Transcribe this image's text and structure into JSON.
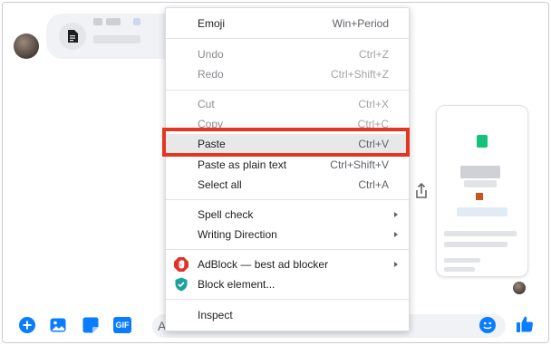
{
  "composer": {
    "input_placeholder": "Aa",
    "icons": [
      "plus-circle-icon",
      "image-icon",
      "sticker-icon",
      "gif-icon",
      "emoji-icon",
      "thumbs-up-icon"
    ],
    "gif_label": "GIF",
    "accent_color": "#0a7cff"
  },
  "context_menu": {
    "emoji": {
      "label": "Emoji",
      "shortcut": "Win+Period"
    },
    "undo": {
      "label": "Undo",
      "shortcut": "Ctrl+Z"
    },
    "redo": {
      "label": "Redo",
      "shortcut": "Ctrl+Shift+Z"
    },
    "cut": {
      "label": "Cut",
      "shortcut": "Ctrl+X"
    },
    "copy": {
      "label": "Copy",
      "shortcut": "Ctrl+C"
    },
    "paste": {
      "label": "Paste",
      "shortcut": "Ctrl+V"
    },
    "paste_plain": {
      "label": "Paste as plain text",
      "shortcut": "Ctrl+Shift+V"
    },
    "select_all": {
      "label": "Select all",
      "shortcut": "Ctrl+A"
    },
    "spell_check": {
      "label": "Spell check"
    },
    "writing_direction": {
      "label": "Writing Direction"
    },
    "adblock": {
      "label": "AdBlock — best ad blocker"
    },
    "block_element": {
      "label": "Block element..."
    },
    "inspect": {
      "label": "Inspect"
    }
  },
  "highlight_color": "#e3351f"
}
